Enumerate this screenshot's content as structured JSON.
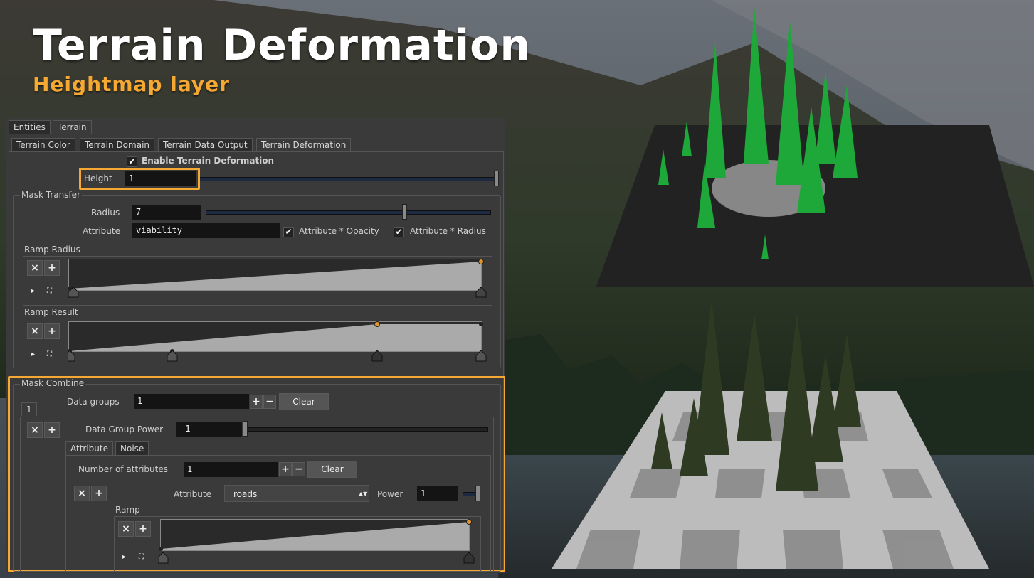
{
  "slide": {
    "title": "Terrain Deformation",
    "subtitle": "Heightmap layer",
    "accent_color": "#f5a832"
  },
  "panel": {
    "top_tabs": [
      "Entities",
      "Terrain"
    ],
    "sub_tabs": [
      "Terrain Color",
      "Terrain Domain",
      "Terrain Data Output",
      "Terrain Deformation"
    ],
    "enable_label": "Enable Terrain Deformation",
    "enable_checked": true,
    "height": {
      "label": "Height",
      "value": "1"
    },
    "mask_transfer": {
      "title": "Mask Transfer",
      "radius_label": "Radius",
      "radius_value": "7",
      "attribute_label": "Attribute",
      "attribute_value": "viability",
      "opacity_label": "Attribute * Opacity",
      "radius_mult_label": "Attribute * Radius",
      "ramp_radius_label": "Ramp Radius",
      "ramp_result_label": "Ramp Result"
    },
    "mask_combine": {
      "title": "Mask Combine",
      "data_groups_label": "Data groups",
      "data_groups_value": "1",
      "clear_label": "Clear",
      "group_tab": "1",
      "power_label": "Data Group Power",
      "power_value": "-1",
      "inner_tabs": [
        "Attribute",
        "Noise"
      ],
      "num_attr_label": "Number of attributes",
      "num_attr_value": "1",
      "clear2_label": "Clear",
      "attribute_label": "Attribute",
      "attribute_select": "roads",
      "power2_label": "Power",
      "power2_value": "1",
      "ramp_label": "Ramp"
    },
    "buttons": {
      "remove": "×",
      "add": "+",
      "plus": "+",
      "minus": "−",
      "play": "▸",
      "frame": "⛶",
      "updown": "▲▼"
    }
  }
}
